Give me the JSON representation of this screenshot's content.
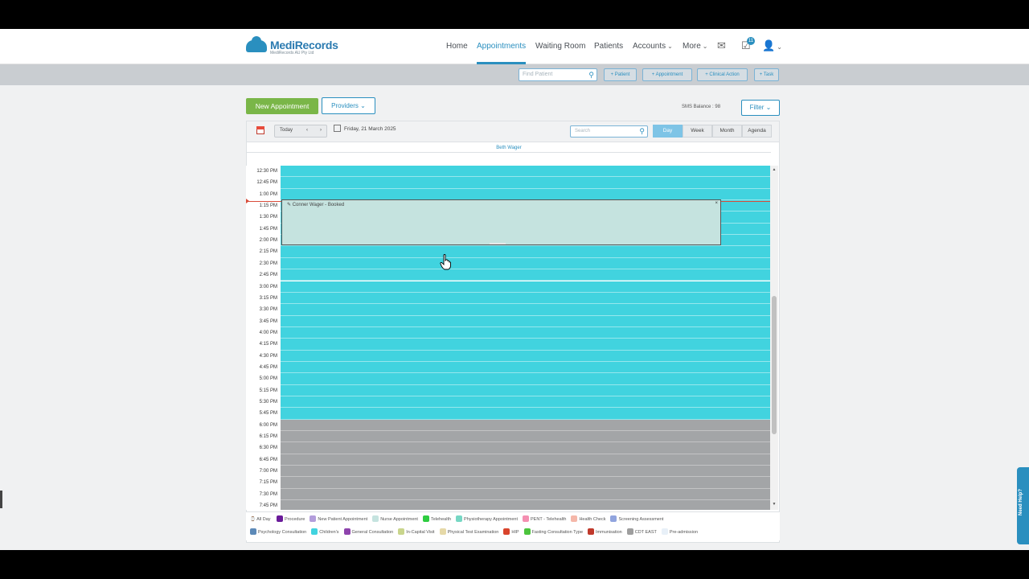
{
  "brand": {
    "name": "MediRecords",
    "tagline": "MediRecords AU Pty Ltd"
  },
  "nav": {
    "items": [
      {
        "label": "Home"
      },
      {
        "label": "Appointments"
      },
      {
        "label": "Waiting Room"
      },
      {
        "label": "Patients"
      },
      {
        "label": "Accounts"
      },
      {
        "label": "More"
      }
    ],
    "tasks_badge": "11"
  },
  "actionbar": {
    "find_placeholder": "Find Patient",
    "buttons": [
      "+ Patient",
      "+ Appointment",
      "+ Clinical Action",
      "+ Task"
    ]
  },
  "controls": {
    "new_appointment": "New Appointment",
    "providers": "Providers",
    "balance": "SMS Balance : 98",
    "filter": "Filter"
  },
  "calendar": {
    "today": "Today",
    "prev": "‹",
    "next": "›",
    "date": "Friday, 21 March 2025",
    "search_placeholder": "Search",
    "views": [
      "Day",
      "Week",
      "Month",
      "Agenda"
    ],
    "active_view": "Day",
    "provider": "Beth Wager",
    "times": [
      "12:30 PM",
      "12:45 PM",
      "1:00 PM",
      "1:15 PM",
      "1:30 PM",
      "1:45 PM",
      "2:00 PM",
      "2:15 PM",
      "2:30 PM",
      "2:45 PM",
      "3:00 PM",
      "3:15 PM",
      "3:30 PM",
      "3:45 PM",
      "4:00 PM",
      "4:15 PM",
      "4:30 PM",
      "4:45 PM",
      "5:00 PM",
      "5:15 PM",
      "5:30 PM",
      "5:45 PM",
      "6:00 PM",
      "6:15 PM",
      "6:30 PM",
      "6:45 PM",
      "7:00 PM",
      "7:15 PM",
      "7:30 PM",
      "7:45 PM"
    ],
    "open_slot_count": 22,
    "appointment": {
      "title": "Conner Wager - Booked",
      "close": "×"
    },
    "colors": {
      "open": "#41d3df",
      "closed": "#a3a5a7",
      "appointment": "#c5e3df",
      "now": "#d94c3a"
    }
  },
  "legend": {
    "all_day": "All Day",
    "row1": [
      {
        "label": "Procedure",
        "color": "#6a1b9a"
      },
      {
        "label": "New Patient Appointment",
        "color": "#b39ddb"
      },
      {
        "label": "Nurse Appointment",
        "color": "#c5e3df"
      },
      {
        "label": "Telehealth",
        "color": "#2ecc40"
      },
      {
        "label": "Physiotherapy Appointment",
        "color": "#76d7c4"
      },
      {
        "label": "PENT - Telehealth",
        "color": "#f48fb1"
      },
      {
        "label": "Health Check",
        "color": "#f5b7a9"
      },
      {
        "label": "Screening Assessment",
        "color": "#90a4de"
      }
    ],
    "row2": [
      {
        "label": "Psychology Consultation",
        "color": "#5d8ab8"
      },
      {
        "label": "Children's",
        "color": "#41d3df"
      },
      {
        "label": "General Consultation",
        "color": "#8e44ad"
      },
      {
        "label": "In-Capital Visit",
        "color": "#c9d58c"
      },
      {
        "label": "Physical Test Examination",
        "color": "#e6d9a8"
      },
      {
        "label": "HIP",
        "color": "#d9442c"
      },
      {
        "label": "Fasting Consultation Type",
        "color": "#4cc43d"
      },
      {
        "label": "Immunisation",
        "color": "#c0392b"
      },
      {
        "label": "CDT EAST",
        "color": "#9e9e9e"
      },
      {
        "label": "Pre-admission",
        "color": "#e8f0f8"
      }
    ]
  },
  "help": {
    "label": "Need Help?"
  }
}
